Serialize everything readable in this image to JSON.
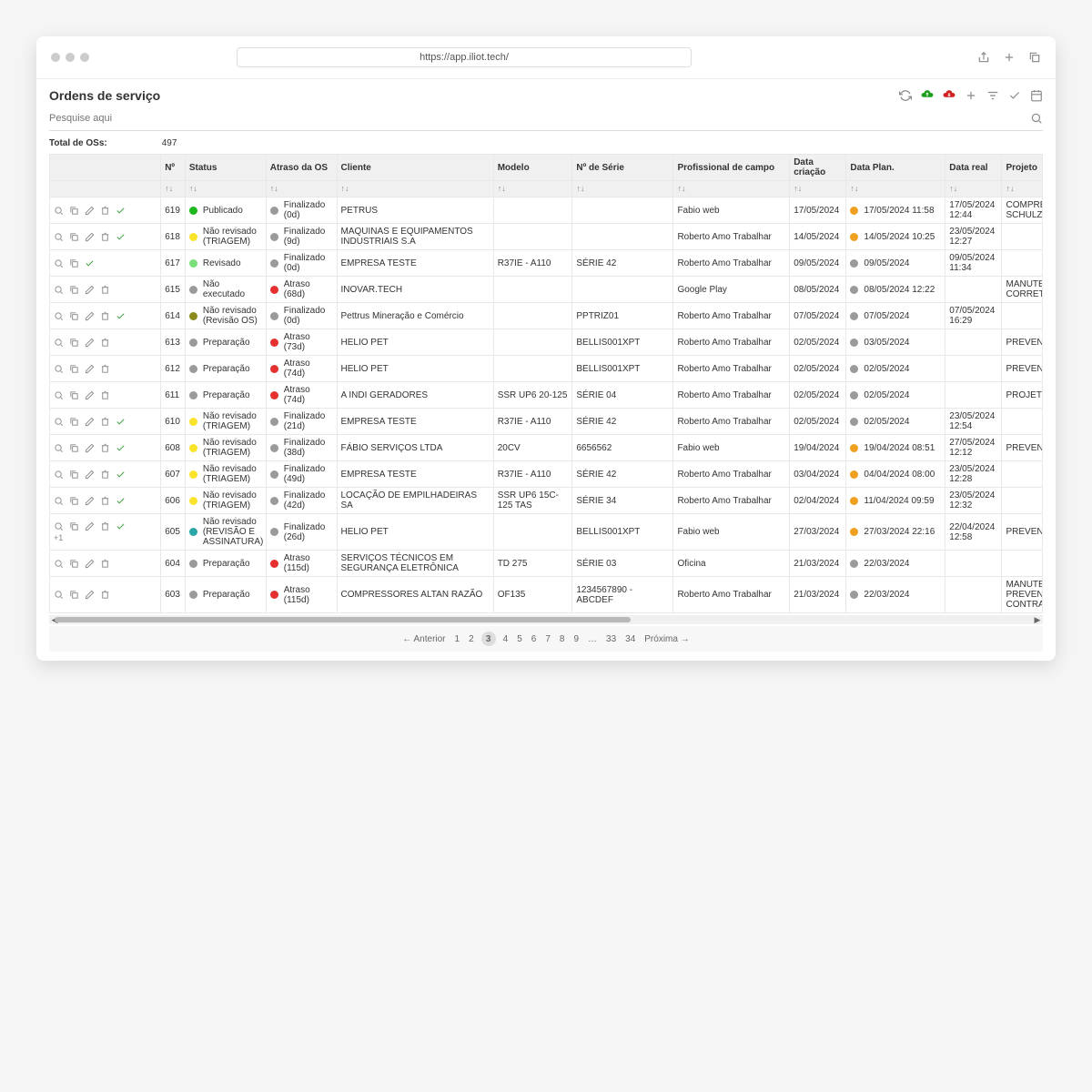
{
  "browser": {
    "url": "https://app.iliot.tech/"
  },
  "page_title": "Ordens de serviço",
  "search": {
    "placeholder": "Pesquise aqui"
  },
  "total": {
    "label": "Total de OSs:",
    "value": "497"
  },
  "columns": [
    "",
    "Nº",
    "Status",
    "Atraso da OS",
    "Cliente",
    "Modelo",
    "Nº de Série",
    "Profissional de campo",
    "Data criação",
    "Data Plan.",
    "Data real",
    "Projeto"
  ],
  "status_colors": {
    "Publicado": "c-verde",
    "Revisado": "c-verde-claro",
    "Não revisado (TRIAGEM)": "c-amarelo",
    "Não executado": "c-cinza",
    "Preparação": "c-cinza",
    "Não revisado (Revisão OS)": "c-oliva",
    "Não revisado (REVISÃO E ASSINATURA)": "c-teal"
  },
  "rows": [
    {
      "n": "619",
      "status": "Publicado",
      "atraso": "Finalizado (0d)",
      "atraso_c": "c-cinza",
      "cliente": "PETRUS",
      "modelo": "",
      "serie": "",
      "prof": "Fabio web",
      "criacao": "17/05/2024",
      "plan": "17/05/2024 11:58",
      "plan_c": "c-laranja",
      "real": "17/05/2024 12:44",
      "proj": "COMPRESSOR SCHULZ",
      "actions": 5
    },
    {
      "n": "618",
      "status": "Não revisado (TRIAGEM)",
      "atraso": "Finalizado (9d)",
      "atraso_c": "c-cinza",
      "cliente": "MAQUINAS E EQUIPAMENTOS INDUSTRIAIS S.A",
      "modelo": "",
      "serie": "",
      "prof": "Roberto Amo Trabalhar",
      "criacao": "14/05/2024",
      "plan": "14/05/2024 10:25",
      "plan_c": "c-laranja",
      "real": "23/05/2024 12:27",
      "proj": "",
      "actions": 5
    },
    {
      "n": "617",
      "status": "Revisado",
      "atraso": "Finalizado (0d)",
      "atraso_c": "c-cinza",
      "cliente": "EMPRESA TESTE",
      "modelo": "R37IE - A110",
      "serie": "SÉRIE 42",
      "prof": "Roberto Amo Trabalhar",
      "criacao": "09/05/2024",
      "plan": "09/05/2024",
      "plan_c": "c-cinza",
      "real": "09/05/2024 11:34",
      "proj": "",
      "actions": 3
    },
    {
      "n": "615",
      "status": "Não executado",
      "atraso": "Atraso (68d)",
      "atraso_c": "c-vermelho",
      "cliente": "INOVAR.TECH",
      "modelo": "",
      "serie": "",
      "prof": "Google Play",
      "criacao": "08/05/2024",
      "plan": "08/05/2024 12:22",
      "plan_c": "c-cinza",
      "real": "",
      "proj": "MANUTENÇÃO CORRETIVA",
      "actions": 4
    },
    {
      "n": "614",
      "status": "Não revisado (Revisão OS)",
      "atraso": "Finalizado (0d)",
      "atraso_c": "c-cinza",
      "cliente": "Pettrus Mineração e Comércio",
      "modelo": "",
      "serie": "PPTRIZ01",
      "prof": "Roberto Amo Trabalhar",
      "criacao": "07/05/2024",
      "plan": "07/05/2024",
      "plan_c": "c-cinza",
      "real": "07/05/2024 16:29",
      "proj": "",
      "actions": 5
    },
    {
      "n": "613",
      "status": "Preparação",
      "atraso": "Atraso (73d)",
      "atraso_c": "c-vermelho",
      "cliente": "HELIO PET",
      "modelo": "",
      "serie": "BELLIS001XPT",
      "prof": "Roberto Amo Trabalhar",
      "criacao": "02/05/2024",
      "plan": "03/05/2024",
      "plan_c": "c-cinza",
      "real": "",
      "proj": "PREVENTIVA",
      "actions": 4
    },
    {
      "n": "612",
      "status": "Preparação",
      "atraso": "Atraso (74d)",
      "atraso_c": "c-vermelho",
      "cliente": "HELIO PET",
      "modelo": "",
      "serie": "BELLIS001XPT",
      "prof": "Roberto Amo Trabalhar",
      "criacao": "02/05/2024",
      "plan": "02/05/2024",
      "plan_c": "c-cinza",
      "real": "",
      "proj": "PREVENTIVA",
      "actions": 4
    },
    {
      "n": "611",
      "status": "Preparação",
      "atraso": "Atraso (74d)",
      "atraso_c": "c-vermelho",
      "cliente": "A INDI GERADORES",
      "modelo": "SSR UP6 20-125",
      "serie": "SÉRIE 04",
      "prof": "Roberto Amo Trabalhar",
      "criacao": "02/05/2024",
      "plan": "02/05/2024",
      "plan_c": "c-cinza",
      "real": "",
      "proj": "PROJETO",
      "actions": 4
    },
    {
      "n": "610",
      "status": "Não revisado (TRIAGEM)",
      "atraso": "Finalizado (21d)",
      "atraso_c": "c-cinza",
      "cliente": "EMPRESA TESTE",
      "modelo": "R37IE - A110",
      "serie": "SÉRIE 42",
      "prof": "Roberto Amo Trabalhar",
      "criacao": "02/05/2024",
      "plan": "02/05/2024",
      "plan_c": "c-cinza",
      "real": "23/05/2024 12:54",
      "proj": "",
      "actions": 5
    },
    {
      "n": "608",
      "status": "Não revisado (TRIAGEM)",
      "atraso": "Finalizado (38d)",
      "atraso_c": "c-cinza",
      "cliente": "FÁBIO SERVIÇOS LTDA",
      "modelo": "20CV",
      "serie": "6656562",
      "prof": "Fabio web",
      "criacao": "19/04/2024",
      "plan": "19/04/2024 08:51",
      "plan_c": "c-laranja",
      "real": "27/05/2024 12:12",
      "proj": "PREVENTIVA",
      "actions": 5
    },
    {
      "n": "607",
      "status": "Não revisado (TRIAGEM)",
      "atraso": "Finalizado (49d)",
      "atraso_c": "c-cinza",
      "cliente": "EMPRESA TESTE",
      "modelo": "R37IE - A110",
      "serie": "SÉRIE 42",
      "prof": "Roberto Amo Trabalhar",
      "criacao": "03/04/2024",
      "plan": "04/04/2024 08:00",
      "plan_c": "c-laranja",
      "real": "23/05/2024 12:28",
      "proj": "",
      "actions": 5
    },
    {
      "n": "606",
      "status": "Não revisado (TRIAGEM)",
      "atraso": "Finalizado (42d)",
      "atraso_c": "c-cinza",
      "cliente": "LOCAÇÃO DE EMPILHADEIRAS SA",
      "modelo": "SSR UP6 15C-125 TAS",
      "serie": "SÉRIE 34",
      "prof": "Roberto Amo Trabalhar",
      "criacao": "02/04/2024",
      "plan": "11/04/2024 09:59",
      "plan_c": "c-laranja",
      "real": "23/05/2024 12:32",
      "proj": "",
      "actions": 5
    },
    {
      "n": "605",
      "status": "Não revisado (REVISÃO E ASSINATURA)",
      "atraso": "Finalizado (26d)",
      "atraso_c": "c-cinza",
      "cliente": "HELIO PET",
      "modelo": "",
      "serie": "BELLIS001XPT",
      "prof": "Fabio web",
      "criacao": "27/03/2024",
      "plan": "27/03/2024 22:16",
      "plan_c": "c-laranja",
      "real": "22/04/2024 12:58",
      "proj": "PREVENTIVA",
      "actions": 5,
      "extra": "+1"
    },
    {
      "n": "604",
      "status": "Preparação",
      "atraso": "Atraso (115d)",
      "atraso_c": "c-vermelho",
      "cliente": "SERVIÇOS TÉCNICOS EM SEGURANÇA ELETRÔNICA",
      "modelo": "TD 275",
      "serie": "SÉRIE 03",
      "prof": "Oficina",
      "criacao": "21/03/2024",
      "plan": "22/03/2024",
      "plan_c": "c-cinza",
      "real": "",
      "proj": "",
      "actions": 4
    },
    {
      "n": "603",
      "status": "Preparação",
      "atraso": "Atraso (115d)",
      "atraso_c": "c-vermelho",
      "cliente": "COMPRESSORES ALTAN RAZÃO",
      "modelo": "OF135",
      "serie": "1234567890 - ABCDEF",
      "prof": "Roberto Amo Trabalhar",
      "criacao": "21/03/2024",
      "plan": "22/03/2024",
      "plan_c": "c-cinza",
      "real": "",
      "proj": "MANUTENÇÃO PREVENTIVA CONTRATO",
      "actions": 4
    }
  ],
  "pagination": {
    "prev": "← Anterior",
    "pages": [
      "1",
      "2",
      "3",
      "4",
      "5",
      "6",
      "7",
      "8",
      "9",
      "…",
      "33",
      "34"
    ],
    "next": "Próxima →",
    "current": "3"
  }
}
